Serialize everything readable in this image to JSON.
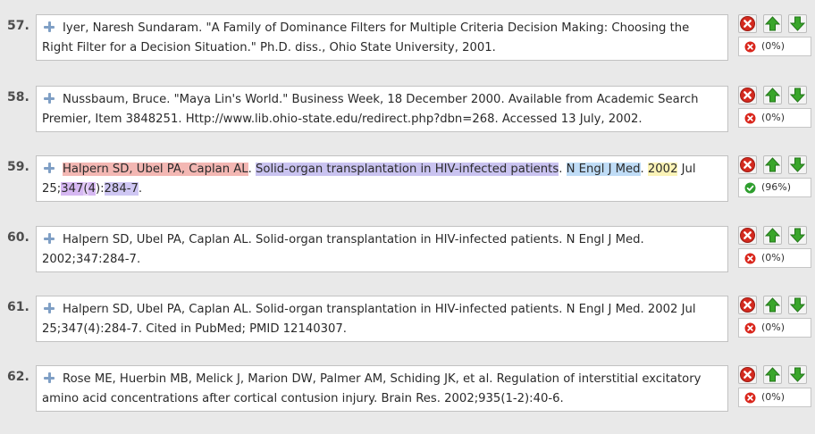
{
  "entries": [
    {
      "number": "57.",
      "text": "Iyer, Naresh Sundaram. \"A Family of Dominance Filters for Multiple Criteria Decision Making: Choosing the Right Filter for a Decision Situation.\" Ph.D. diss., Ohio State University, 2001.",
      "score": "(0%)",
      "status": "fail"
    },
    {
      "number": "58.",
      "text": "Nussbaum, Bruce. \"Maya Lin's World.\" Business Week, 18 December 2000. Available from Academic Search Premier, Item 3848251. Http://www.lib.ohio-state.edu/redirect.php?dbn=268. Accessed 13 July, 2002.",
      "score": "(0%)",
      "status": "fail"
    },
    {
      "number": "59.",
      "segments": {
        "author": "Halpern SD, Ubel PA, Caplan AL",
        "sep1": ". ",
        "title": "Solid-organ transplantation in HIV-infected patients",
        "sep2": ". ",
        "journal": "N Engl J Med",
        "sep3": ". ",
        "year": "2002",
        "date_rest": " Jul 25;",
        "volume": "347",
        "issue_open": "(",
        "issue": "4",
        "issue_close": "):",
        "pages": "284-7",
        "end": "."
      },
      "score": "(96%)",
      "status": "pass"
    },
    {
      "number": "60.",
      "text": "Halpern SD, Ubel PA, Caplan AL. Solid-organ transplantation in HIV-infected patients. N Engl J Med. 2002;347:284-7.",
      "score": "(0%)",
      "status": "fail"
    },
    {
      "number": "61.",
      "text": "Halpern SD, Ubel PA, Caplan AL. Solid-organ transplantation in HIV-infected patients. N Engl J Med. 2002 Jul 25;347(4):284-7. Cited in PubMed; PMID 12140307.",
      "score": "(0%)",
      "status": "fail"
    },
    {
      "number": "62.",
      "text": "Rose ME, Huerbin MB, Melick J, Marion DW, Palmer AM, Schiding JK, et al. Regulation of interstitial excitatory amino acid concentrations after cortical contusion injury. Brain Res. 2002;935(1-2):40-6.",
      "score": "(0%)",
      "status": "fail"
    }
  ],
  "icons": {
    "expand": "plus-icon",
    "delete": "delete-icon",
    "move_up": "arrow-up-icon",
    "move_down": "arrow-down-icon",
    "fail": "x-circle-icon",
    "pass": "check-circle-icon"
  },
  "colors": {
    "background": "#e9e9e9",
    "delete_red": "#d42a1f",
    "arrow_green": "#3aa62b",
    "check_green": "#2e9e2e",
    "fail_red": "#d9261c",
    "expand_blue": "#7f9fc5",
    "highlight_author": "#f3b7b3",
    "highlight_title": "#c9c3f0",
    "highlight_journal": "#bfdcf6",
    "highlight_year": "#fbf3b7",
    "highlight_volume": "#d6b8f2",
    "highlight_pages": "#cfc7f3"
  }
}
